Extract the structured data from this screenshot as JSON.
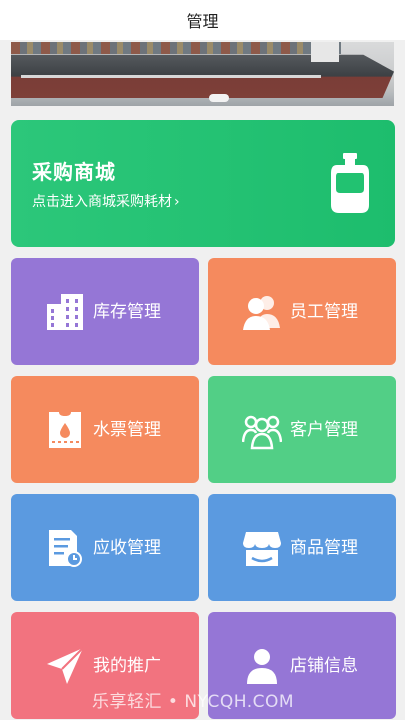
{
  "header": {
    "title": "管理"
  },
  "mall_card": {
    "title": "采购商城",
    "subtitle": "点击进入商城采购耗材",
    "arrow": "›",
    "icon": "water-bottle-icon",
    "color": "#22c271"
  },
  "tiles": [
    {
      "label": "库存管理",
      "icon": "buildings-icon",
      "color": "#9576d6"
    },
    {
      "label": "员工管理",
      "icon": "users-icon",
      "color": "#f58a5e"
    },
    {
      "label": "水票管理",
      "icon": "water-ticket-icon",
      "color": "#f58a5e"
    },
    {
      "label": "客户管理",
      "icon": "customers-icon",
      "color": "#52cf86"
    },
    {
      "label": "应收管理",
      "icon": "receivable-doc-icon",
      "color": "#5b9ae0"
    },
    {
      "label": "商品管理",
      "icon": "store-icon",
      "color": "#5b9ae0"
    },
    {
      "label": "我的推广",
      "icon": "send-icon",
      "color": "#f2737f"
    },
    {
      "label": "店铺信息",
      "icon": "shop-info-icon",
      "color": "#9576d6"
    }
  ],
  "watermark": "乐享轻汇 • NYCQH.COM"
}
